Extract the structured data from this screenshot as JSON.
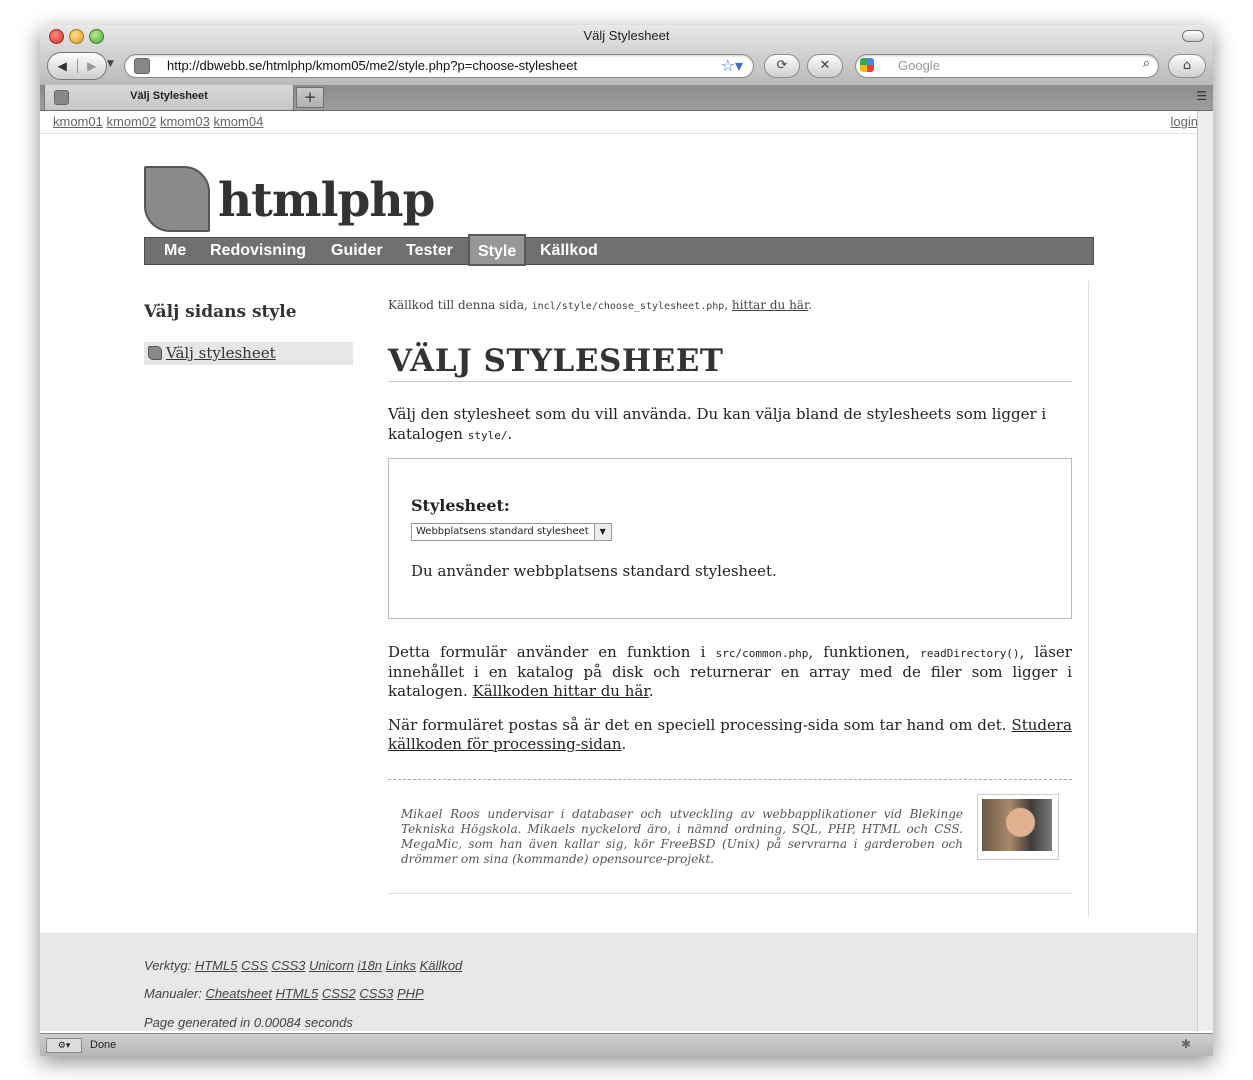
{
  "window": {
    "title": "Välj Stylesheet",
    "url": "http://dbwebb.se/htmlphp/kmom05/me2/style.php?p=choose-stylesheet",
    "search_placeholder": "Google",
    "tab_title": "Välj Stylesheet",
    "new_tab_label": "+",
    "status_text": "Done"
  },
  "topbar": {
    "links": [
      "kmom01",
      "kmom02",
      "kmom03",
      "kmom04"
    ],
    "login": "login"
  },
  "header": {
    "logo_text": "htmlphp"
  },
  "nav": {
    "items": [
      "Me",
      "Redovisning",
      "Guider",
      "Tester",
      "Style",
      "Källkod"
    ],
    "active": "Style"
  },
  "sidebar": {
    "title": "Välj sidans style",
    "items": [
      "Välj stylesheet"
    ]
  },
  "main": {
    "src_prefix": "Källkod till denna sida,",
    "src_file": "incl/style/choose_stylesheet.php",
    "src_link": "hittar du här",
    "heading": "VÄLJ STYLESHEET",
    "intro": "Välj den stylesheet som du vill använda. Du kan välja bland de stylesheets som ligger i katalogen",
    "intro_code": "style/",
    "form_label": "Stylesheet:",
    "select_value": "Webbplatsens standard stylesheet",
    "status": "Du använder webbplatsens standard stylesheet.",
    "p1_a": "Detta formulär använder en funktion i",
    "p1_code1": "src/common.php",
    "p1_b": ", funktionen,",
    "p1_code2": "readDirectory()",
    "p1_c": ", läser innehållet i en katalog på disk och returnerar en array med de filer som ligger i katalogen.",
    "p1_link": "Källkoden hittar du här",
    "p2_a": "När formuläret postas så är det en speciell processing-sida som tar hand om det.",
    "p2_link": "Studera källkoden för processing-sidan",
    "byline": "Mikael Roos undervisar i databaser och utveckling av webbapplikationer vid Blekinge Tekniska Högskola. Mikaels nyckelord äro, i nämnd ordning, SQL, PHP, HTML och CSS. MegaMic, som han även kallar sig, kör FreeBSD (Unix) på servrarna i garderoben och drömmer om sina (kommande) opensource-projekt."
  },
  "footer": {
    "tools_label": "Verktyg:",
    "tools": [
      "HTML5",
      "CSS",
      "CSS3",
      "Unicorn",
      "i18n",
      "Links",
      "Källkod"
    ],
    "manuals_label": "Manualer:",
    "manuals": [
      "Cheatsheet",
      "HTML5",
      "CSS2",
      "CSS3",
      "PHP"
    ],
    "generated": "Page generated in 0.00084 seconds"
  },
  "icons": {
    "back": "back-arrow-icon",
    "forward": "forward-arrow-icon",
    "bookmark": "star-icon",
    "reload": "reload-icon",
    "stop": "stop-icon",
    "search": "magnifier-icon",
    "home": "home-icon"
  }
}
